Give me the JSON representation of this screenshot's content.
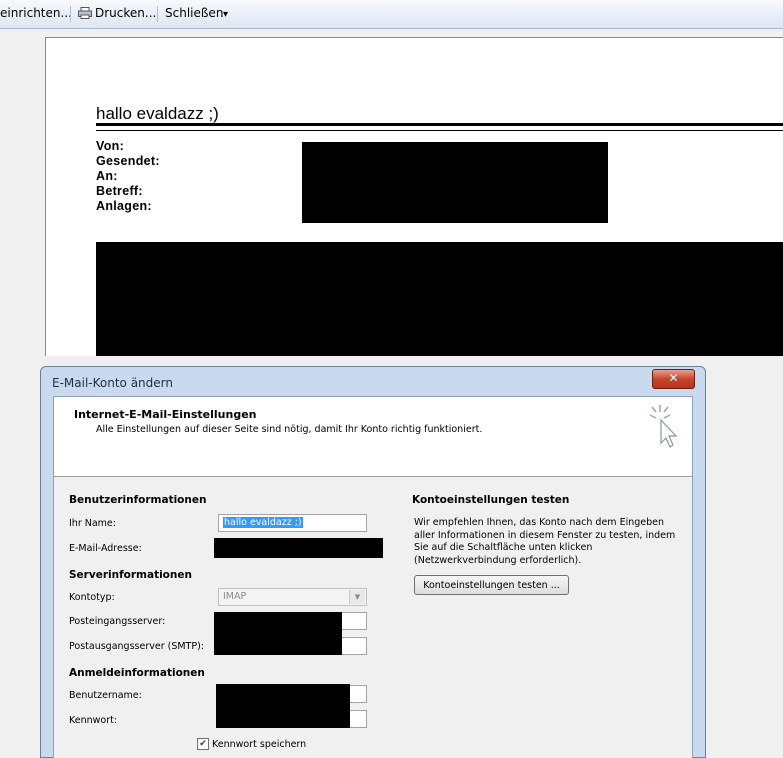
{
  "toolbar": {
    "einrichten": "einrichten...",
    "drucken": "Drucken...",
    "schliessen": "Schließen",
    "more": "▾"
  },
  "preview": {
    "subject_heading": "hallo evaldazz ;)",
    "labels": [
      "Von:",
      "Gesendet:",
      "An:",
      "Betreff:",
      "Anlagen:"
    ]
  },
  "dialog": {
    "title": "E-Mail-Konto ändern",
    "close": "✕",
    "heading": "Internet-E-Mail-Einstellungen",
    "subheading": "Alle Einstellungen auf dieser Seite sind nötig, damit Ihr Konto richtig funktioniert.",
    "benutzer_section": "Benutzerinformationen",
    "name_label": "Ihr Name:",
    "name_value": "hallo evaldazz ;)",
    "email_label": "E-Mail-Adresse:",
    "server_section": "Serverinformationen",
    "kontotyp_label": "Kontotyp:",
    "kontotyp_value": "IMAP",
    "posteingang_label": "Posteingangsserver:",
    "postausgang_label": "Postausgangsserver (SMTP):",
    "anmelde_section": "Anmeldeinformationen",
    "benutzername_label": "Benutzername:",
    "kennwort_label": "Kennwort:",
    "kennwort_speichern": "Kennwort speichern",
    "kennwort_speichern_checked": true,
    "test_section": "Kontoeinstellungen testen",
    "test_description": "Wir empfehlen Ihnen, das Konto nach dem Eingeben aller Informationen in diesem Fenster zu testen, indem Sie auf die Schaltfläche unten klicken (Netzwerkverbindung erforderlich).",
    "test_button": "Kontoeinstellungen testen ..."
  }
}
